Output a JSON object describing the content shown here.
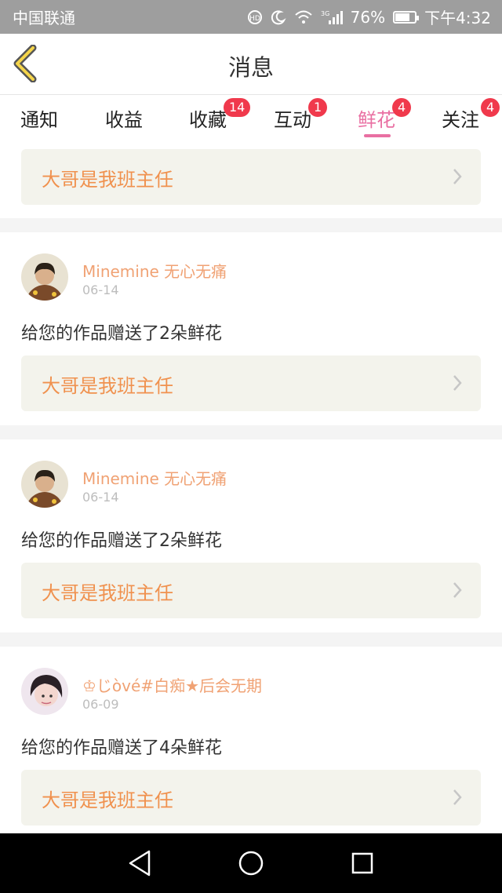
{
  "status_bar": {
    "carrier": "中国联通",
    "battery": "76%",
    "time": "下午4:32",
    "icons": [
      "hd-call-icon",
      "moon-icon",
      "wifi-icon",
      "3g-signal-icon",
      "battery-icon"
    ]
  },
  "header": {
    "title": "消息",
    "back_icon": "chevron-left-icon"
  },
  "tabs": [
    {
      "label": "通知",
      "badge": ""
    },
    {
      "label": "收益",
      "badge": ""
    },
    {
      "label": "收藏",
      "badge": "14"
    },
    {
      "label": "互动",
      "badge": "1"
    },
    {
      "label": "鲜花",
      "badge": "4",
      "active": true
    },
    {
      "label": "关注",
      "badge": "4"
    }
  ],
  "colors": {
    "accent": "#e96fa2",
    "badge": "#f0394c",
    "work_text": "#f0914e",
    "username": "#f0a274"
  },
  "top_link": {
    "label": "大哥是我班主任"
  },
  "messages": [
    {
      "username": "Minemine 无心无痛",
      "date": "06-14",
      "text": "给您的作品赠送了2朵鲜花",
      "work": "大哥是我班主任"
    },
    {
      "username": "Minemine 无心无痛",
      "date": "06-14",
      "text": "给您的作品赠送了2朵鲜花",
      "work": "大哥是我班主任"
    },
    {
      "username": "♔じòvé#白痴★后会无期",
      "date": "06-09",
      "text": "给您的作品赠送了4朵鲜花",
      "work": "大哥是我班主任"
    }
  ],
  "nav": {
    "back": "triangle-back-icon",
    "home": "circle-home-icon",
    "recent": "square-recent-icon"
  }
}
